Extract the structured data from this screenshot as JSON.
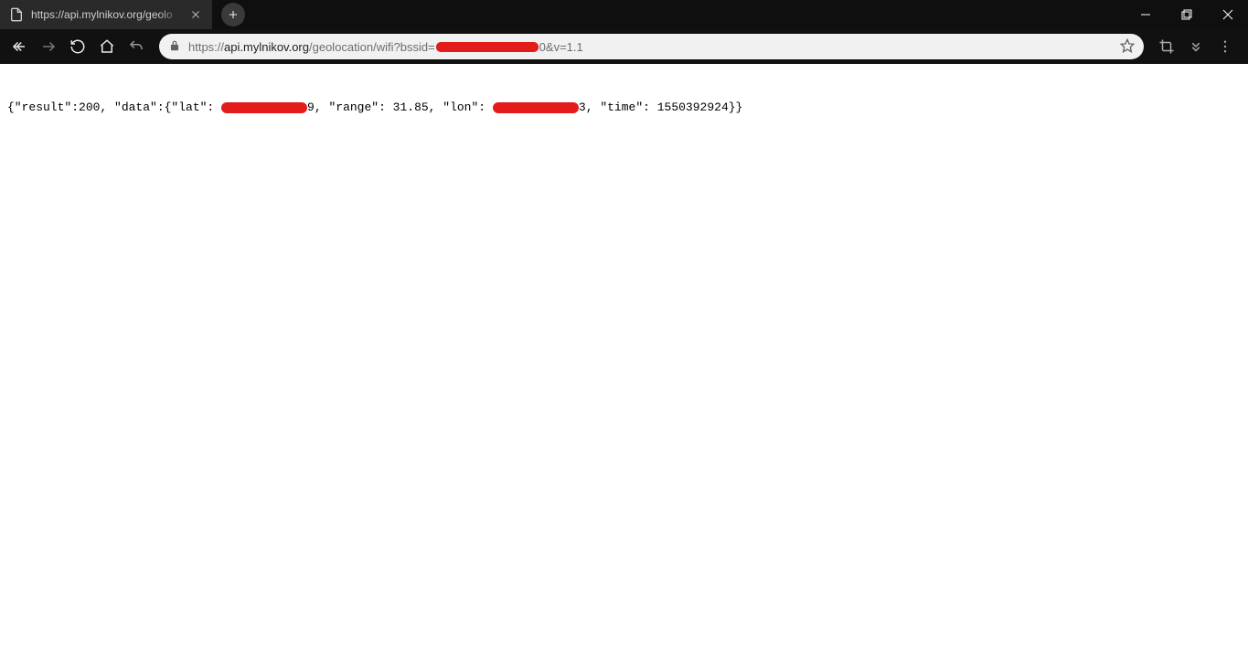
{
  "tab": {
    "title": "https://api.mylnikov.org/geolo"
  },
  "url": {
    "scheme": "https://",
    "host": "api.mylnikov.org",
    "path_before_redact": "/geolocation/wifi?bssid=",
    "path_after_redact": "0&v=1.1"
  },
  "page": {
    "json": {
      "seg1": "{\"result\":200, \"data\":{\"lat\": ",
      "lat_tail": "9",
      "seg2": ", \"range\": 31.85, \"lon\": ",
      "lon_tail": "3",
      "seg3": ", \"time\": 1550392924}}"
    }
  }
}
